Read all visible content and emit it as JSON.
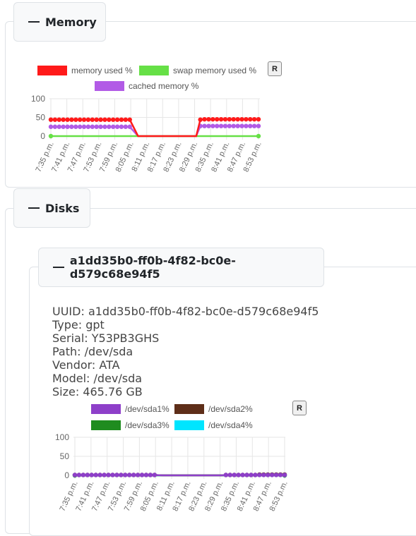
{
  "memory": {
    "title": "Memory",
    "reset_label": "R",
    "legend": [
      {
        "label": "memory used %",
        "color": "#ff1a1a"
      },
      {
        "label": "swap memory used %",
        "color": "#66e046"
      },
      {
        "label": "cached memory %",
        "color": "#b25be6"
      }
    ]
  },
  "disks": {
    "title": "Disks",
    "disk": {
      "title": "a1dd35b0-ff0b-4f82-bc0e-d579c68e94f5",
      "uuid": "UUID: a1dd35b0-ff0b-4f82-bc0e-d579c68e94f5",
      "type": "Type: gpt",
      "serial": "Serial: Y53PB3GHS",
      "path": "Path: /dev/sda",
      "vendor": "Vendor: ATA",
      "model": "Model: /dev/sda",
      "size": "Size: 465.76 GB",
      "reset_label": "R",
      "legend": [
        {
          "label": "/dev/sda1%",
          "color": "#8e3fc9"
        },
        {
          "label": "/dev/sda2%",
          "color": "#5e2e19"
        },
        {
          "label": "/dev/sda3%",
          "color": "#1f8c1f"
        },
        {
          "label": "/dev/sda4%",
          "color": "#00e5ff"
        }
      ]
    }
  },
  "chart_data": [
    {
      "type": "line",
      "title": "",
      "x": [
        "7:35 p.m.",
        "7:41 p.m.",
        "7:47 p.m.",
        "7:53 p.m.",
        "7:59 p.m.",
        "8:05 p.m.",
        "8:11 p.m.",
        "8:17 p.m.",
        "8:23 p.m.",
        "8:29 p.m.",
        "8:35 p.m.",
        "8:41 p.m.",
        "8:47 p.m.",
        "8:53 p.m."
      ],
      "yticks": [
        "100",
        "50",
        "0"
      ],
      "ylim": [
        0,
        100
      ],
      "grid": true,
      "series": [
        {
          "name": "memory used %",
          "color": "#ff1a1a",
          "points": [
            [
              0,
              44
            ],
            [
              1,
              44
            ],
            [
              2,
              44
            ],
            [
              3,
              44
            ],
            [
              4,
              44
            ],
            [
              5,
              44
            ],
            [
              6,
              44
            ],
            [
              7,
              44
            ],
            [
              8,
              44
            ],
            [
              9,
              44
            ],
            [
              10,
              44
            ],
            [
              11,
              44
            ],
            [
              12,
              44
            ],
            [
              13,
              44
            ],
            [
              14,
              44
            ],
            [
              15,
              44
            ],
            [
              16,
              44
            ],
            [
              17,
              44
            ],
            [
              18,
              44
            ],
            [
              19,
              44
            ],
            [
              21,
              0
            ],
            [
              35,
              0
            ],
            [
              36,
              44
            ],
            [
              37,
              45
            ],
            [
              38,
              45
            ],
            [
              39,
              45
            ],
            [
              40,
              45
            ],
            [
              41,
              45
            ],
            [
              42,
              45
            ],
            [
              43,
              45
            ],
            [
              44,
              45
            ],
            [
              45,
              45
            ],
            [
              46,
              45
            ],
            [
              47,
              45
            ],
            [
              48,
              45
            ],
            [
              49,
              45
            ],
            [
              50,
              45
            ]
          ]
        },
        {
          "name": "swap memory used %",
          "color": "#66e046",
          "points": [
            [
              0,
              0
            ],
            [
              50,
              0
            ]
          ]
        },
        {
          "name": "cached memory %",
          "color": "#b25be6",
          "points": [
            [
              0,
              25
            ],
            [
              1,
              25
            ],
            [
              2,
              25
            ],
            [
              3,
              25
            ],
            [
              4,
              25
            ],
            [
              5,
              25
            ],
            [
              6,
              25
            ],
            [
              7,
              25
            ],
            [
              8,
              25
            ],
            [
              9,
              25
            ],
            [
              10,
              25
            ],
            [
              11,
              25
            ],
            [
              12,
              25
            ],
            [
              13,
              25
            ],
            [
              14,
              25
            ],
            [
              15,
              25
            ],
            [
              16,
              25
            ],
            [
              17,
              25
            ],
            [
              18,
              25
            ],
            [
              19,
              25
            ],
            [
              21,
              0
            ],
            [
              35,
              0
            ],
            [
              36,
              27
            ],
            [
              37,
              27
            ],
            [
              38,
              27
            ],
            [
              39,
              27
            ],
            [
              40,
              27
            ],
            [
              41,
              27
            ],
            [
              42,
              27
            ],
            [
              43,
              27
            ],
            [
              44,
              27
            ],
            [
              45,
              27
            ],
            [
              46,
              27
            ],
            [
              47,
              27
            ],
            [
              48,
              27
            ],
            [
              49,
              27
            ],
            [
              50,
              27
            ]
          ]
        }
      ]
    },
    {
      "type": "line",
      "title": "",
      "x": [
        "7:35 p.m.",
        "7:41 p.m.",
        "7:47 p.m.",
        "7:53 p.m.",
        "7:59 p.m.",
        "8:05 p.m.",
        "8:11 p.m.",
        "8:17 p.m.",
        "8:23 p.m.",
        "8:29 p.m.",
        "8:35 p.m.",
        "8:41 p.m.",
        "8:47 p.m.",
        "8:53 p.m."
      ],
      "yticks": [
        "100",
        "50",
        "0"
      ],
      "ylim": [
        0,
        100
      ],
      "grid": true,
      "series": [
        {
          "name": "/dev/sda1%",
          "color": "#8e3fc9",
          "points": [
            [
              0,
              1
            ],
            [
              1,
              1
            ],
            [
              2,
              1
            ],
            [
              3,
              1
            ],
            [
              4,
              1
            ],
            [
              5,
              1
            ],
            [
              6,
              1
            ],
            [
              7,
              1
            ],
            [
              8,
              1
            ],
            [
              9,
              1
            ],
            [
              10,
              1
            ],
            [
              11,
              1
            ],
            [
              12,
              1
            ],
            [
              13,
              1
            ],
            [
              14,
              1
            ],
            [
              15,
              1
            ],
            [
              16,
              1
            ],
            [
              17,
              1
            ],
            [
              18,
              1
            ],
            [
              19,
              1
            ],
            [
              21,
              0
            ],
            [
              35,
              0
            ],
            [
              36,
              1
            ],
            [
              37,
              1
            ],
            [
              38,
              1
            ],
            [
              39,
              1
            ],
            [
              40,
              1
            ],
            [
              41,
              1
            ],
            [
              42,
              1
            ],
            [
              43,
              1
            ],
            [
              44,
              1
            ],
            [
              45,
              1
            ],
            [
              46,
              1
            ],
            [
              47,
              1
            ],
            [
              48,
              1
            ],
            [
              49,
              1
            ],
            [
              50,
              1
            ]
          ]
        },
        {
          "name": "/dev/sda2%",
          "color": "#5e2e19",
          "points": [
            [
              0,
              1
            ],
            [
              1,
              1
            ],
            [
              2,
              1
            ],
            [
              3,
              1
            ],
            [
              4,
              1
            ],
            [
              5,
              1
            ],
            [
              6,
              1
            ],
            [
              7,
              1
            ],
            [
              8,
              1
            ],
            [
              9,
              1
            ],
            [
              10,
              1
            ],
            [
              11,
              1
            ],
            [
              12,
              1
            ],
            [
              13,
              1
            ],
            [
              14,
              1
            ],
            [
              15,
              1
            ],
            [
              16,
              1
            ],
            [
              17,
              1
            ],
            [
              18,
              1
            ],
            [
              19,
              1
            ],
            [
              21,
              0
            ],
            [
              35,
              0
            ],
            [
              36,
              1
            ],
            [
              37,
              1
            ],
            [
              38,
              1
            ],
            [
              39,
              1
            ],
            [
              40,
              1
            ],
            [
              41,
              1
            ],
            [
              42,
              1
            ],
            [
              43,
              1
            ],
            [
              44,
              2
            ],
            [
              45,
              2
            ],
            [
              46,
              2
            ],
            [
              47,
              2
            ],
            [
              48,
              2
            ],
            [
              49,
              2
            ],
            [
              50,
              2
            ]
          ]
        },
        {
          "name": "/dev/sda3%",
          "color": "#1f8c1f",
          "points": [
            [
              0,
              0
            ],
            [
              50,
              0
            ]
          ]
        },
        {
          "name": "/dev/sda4%",
          "color": "#00e5ff",
          "points": [
            [
              0,
              0
            ],
            [
              50,
              0
            ]
          ]
        }
      ]
    }
  ]
}
